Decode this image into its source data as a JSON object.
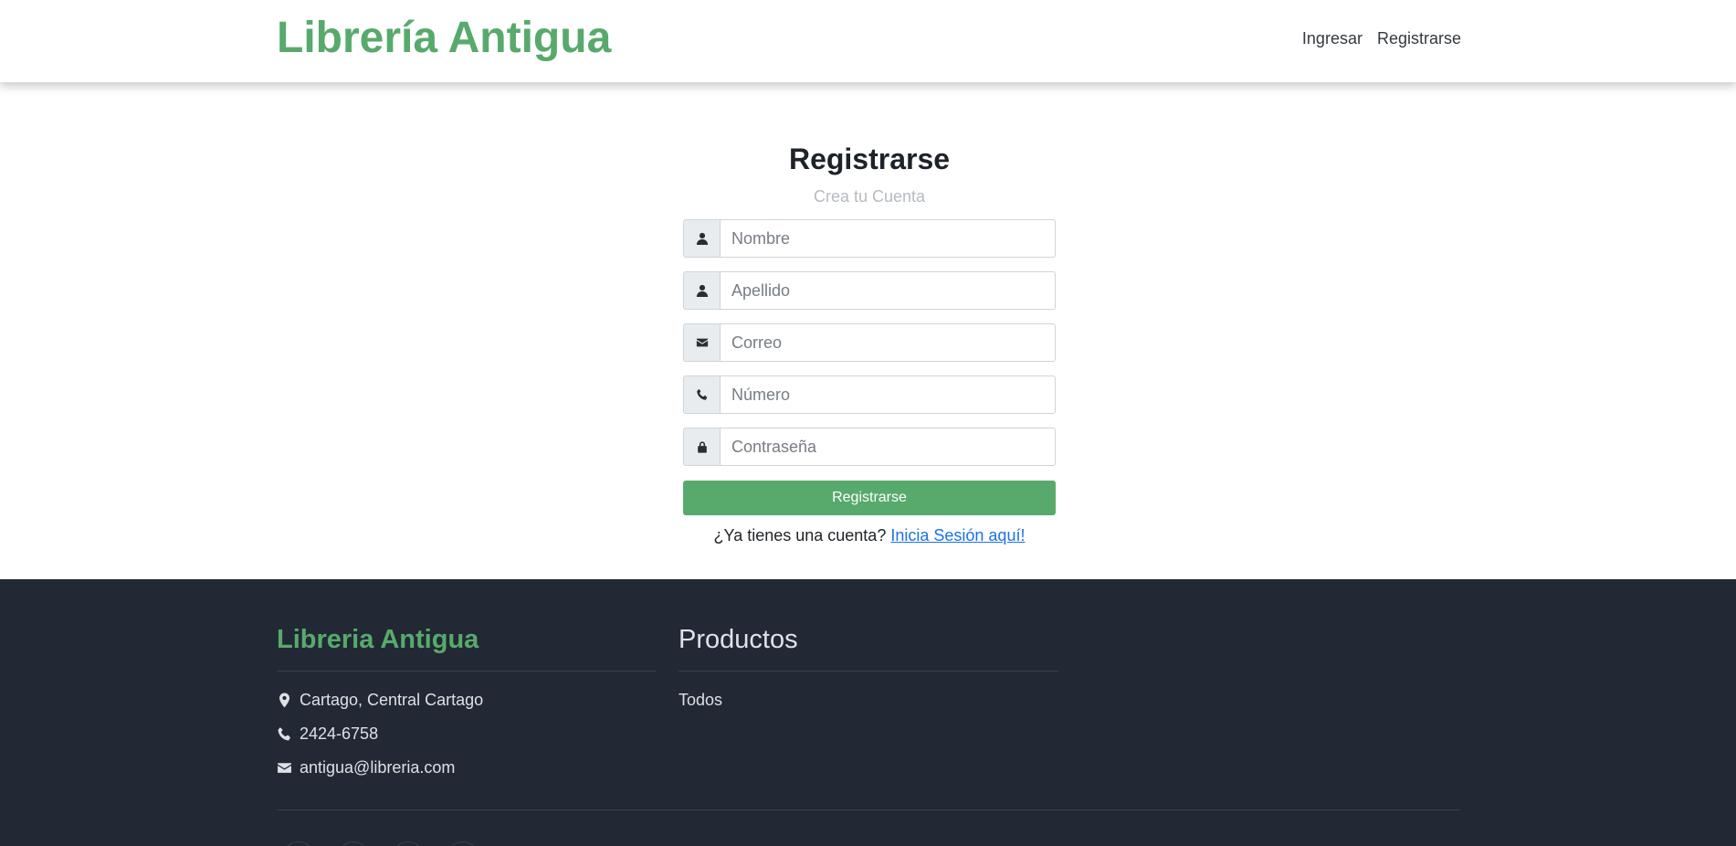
{
  "header": {
    "brand": "Librería Antigua",
    "nav": {
      "login": "Ingresar",
      "register": "Registrarse"
    }
  },
  "form": {
    "title": "Registrarse",
    "subtitle": "Crea tu Cuenta",
    "fields": {
      "first_name": {
        "placeholder": "Nombre",
        "icon": "user-icon"
      },
      "last_name": {
        "placeholder": "Apellido",
        "icon": "user-icon"
      },
      "email": {
        "placeholder": "Correo",
        "icon": "envelope-icon"
      },
      "phone": {
        "placeholder": "Número",
        "icon": "phone-icon"
      },
      "password": {
        "placeholder": "Contraseña",
        "icon": "lock-icon"
      }
    },
    "submit": "Registrarse",
    "login_prompt": "¿Ya tienes una cuenta?",
    "login_link": "Inicia Sesión aquí!"
  },
  "footer": {
    "brand": "Libreria Antigua",
    "address": "Cartago, Central Cartago",
    "phone": "2424-6758",
    "email": "antigua@libreria.com",
    "products_title": "Productos",
    "products_links": [
      "Todos"
    ]
  },
  "colors": {
    "accent": "#58aa6c",
    "footer_bg": "#222834",
    "link": "#1a73e8"
  }
}
